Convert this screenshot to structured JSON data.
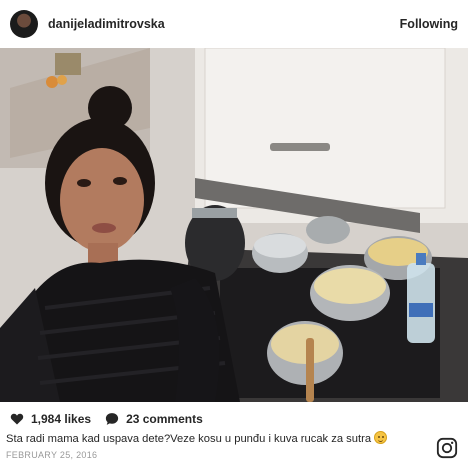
{
  "post": {
    "username": "danijeladimitrovska",
    "follow_label": "Following",
    "likes": "1,984 likes",
    "comments": "23 comments",
    "caption": "Sta radi mama kad uspava dete?Veze kosu u punđu i kuva rucak za sutra",
    "date": "FEBRUARY 25, 2016"
  },
  "icons": {
    "like": "heart-icon",
    "comment": "speech-bubble-icon",
    "emoji": "smiley-emoji",
    "brand": "instagram-icon"
  },
  "colors": {
    "text": "#262626",
    "muted": "#999999",
    "background": "#ffffff"
  }
}
